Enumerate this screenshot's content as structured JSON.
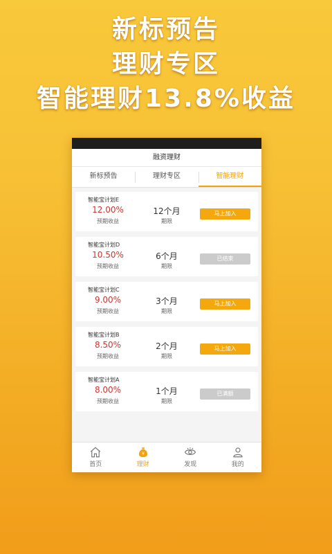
{
  "banner": {
    "line1": "新标预告",
    "line2": "理财专区",
    "line3": "智能理财13.8%收益"
  },
  "app": {
    "title": "融资理财",
    "tabs": [
      {
        "label": "新标预告",
        "active": false
      },
      {
        "label": "理财专区",
        "active": false
      },
      {
        "label": "智能理财",
        "active": true
      }
    ],
    "products": [
      {
        "name": "智能宝计划E",
        "rate": "12.00%",
        "rate_label": "预期收益",
        "term": "12个月",
        "term_label": "期限",
        "action": "马上加入",
        "enabled": true
      },
      {
        "name": "智能宝计划D",
        "rate": "10.50%",
        "rate_label": "预期收益",
        "term": "6个月",
        "term_label": "期限",
        "action": "已结束",
        "enabled": false
      },
      {
        "name": "智能宝计划C",
        "rate": "9.00%",
        "rate_label": "预期收益",
        "term": "3个月",
        "term_label": "期限",
        "action": "马上加入",
        "enabled": true
      },
      {
        "name": "智能宝计划B",
        "rate": "8.50%",
        "rate_label": "预期收益",
        "term": "2个月",
        "term_label": "期限",
        "action": "马上加入",
        "enabled": true
      },
      {
        "name": "智能宝计划A",
        "rate": "8.00%",
        "rate_label": "预期收益",
        "term": "1个月",
        "term_label": "期限",
        "action": "已满额",
        "enabled": false
      }
    ],
    "nav": [
      {
        "label": "首页",
        "icon": "home-icon",
        "active": false
      },
      {
        "label": "理财",
        "icon": "money-bag-icon",
        "active": true
      },
      {
        "label": "发现",
        "icon": "eye-icon",
        "active": false
      },
      {
        "label": "我的",
        "icon": "user-icon",
        "active": false
      }
    ]
  },
  "colors": {
    "accent": "#f2a20d",
    "rate_red": "#d4322c",
    "disabled_gray": "#cbcbcb"
  }
}
